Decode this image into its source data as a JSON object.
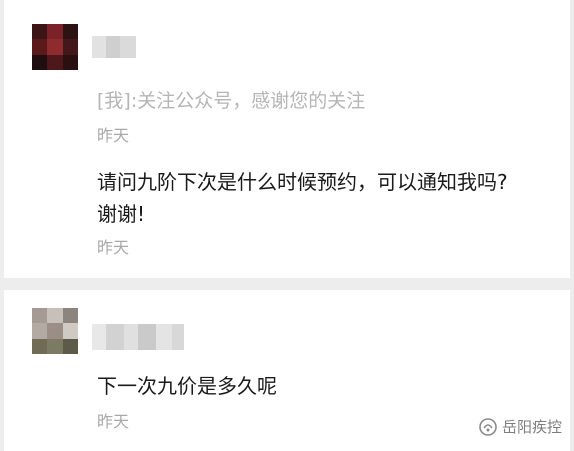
{
  "comments": [
    {
      "reply": "[我]:关注公众号，感谢您的关注",
      "reply_time": "昨天",
      "text_line1": "请问九阶下次是什么时候预约，可以通知我吗?",
      "text_line2": "谢谢!",
      "time": "昨天"
    },
    {
      "text": "下一次九价是多久呢",
      "time": "昨天"
    }
  ],
  "watermark": {
    "text": "岳阳疾控",
    "icon": "wechat-official-account-icon"
  },
  "colors": {
    "background": "#ededed",
    "card": "#ffffff",
    "text": "#1a1a1a",
    "muted": "#b5b5b5"
  }
}
